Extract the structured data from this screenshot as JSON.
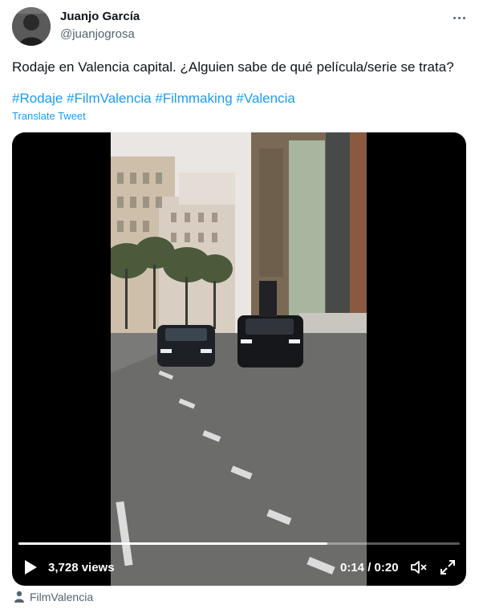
{
  "author": {
    "name": "Juanjo García",
    "handle": "@juanjogrosa"
  },
  "tweet": {
    "text": "Rodaje en Valencia capital. ¿Alguien sabe de qué película/serie se trata?",
    "hashtags": [
      "#Rodaje",
      "#FilmValencia",
      "#Filmmaking",
      "#Valencia"
    ],
    "translate_label": "Translate Tweet"
  },
  "video": {
    "views": "3,728 views",
    "time": "0:14 / 0:20",
    "progress": 0.7
  },
  "tagged_user": "FilmValencia",
  "icons": {
    "more": "more-icon",
    "play": "play-icon",
    "volume": "volume-icon",
    "fullscreen": "fullscreen-icon",
    "person": "person-icon"
  },
  "colors": {
    "accent": "#1d9bf0",
    "secondary_text": "#536471"
  }
}
